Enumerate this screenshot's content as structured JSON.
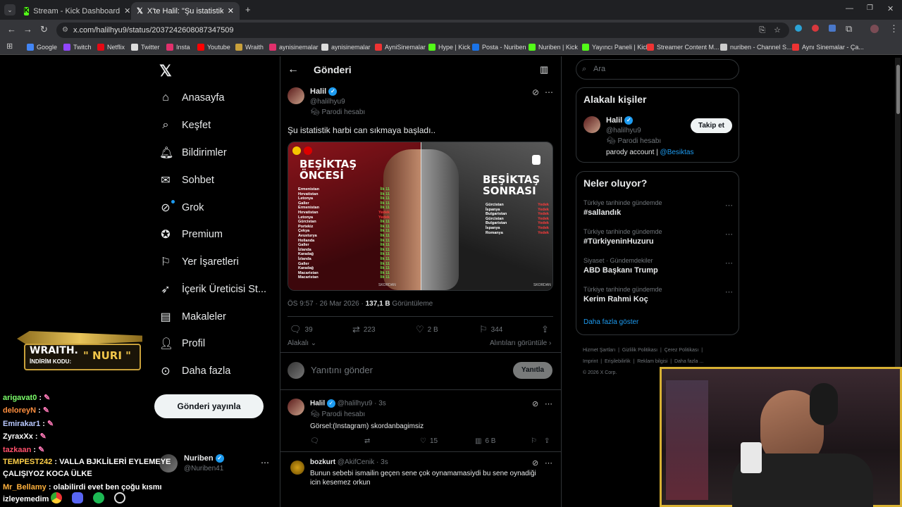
{
  "browser": {
    "tabs": [
      "Stream - Kick Dashboard",
      "X'te Halil: \"Şu istatistik harbi ca"
    ],
    "url": "x.com/halilhyu9/status/2037242608087347509",
    "bookmarks": [
      "Google",
      "Twitch",
      "Netflix",
      "Twitter",
      "Insta",
      "Youtube",
      "Wraith",
      "aynisinemalar",
      "aynisinemalar",
      "AyniSinemalar",
      "Hype | Kick",
      "Posta - Nuriben",
      "Nuriben | Kick",
      "Yayıncı Paneli | Kick",
      "Streamer Content M...",
      "nuriben - Channel S...",
      "Aynı Sinemalar - Ça..."
    ]
  },
  "nav": {
    "items": [
      "Anasayfa",
      "Keşfet",
      "Bildirimler",
      "Sohbet",
      "Grok",
      "Premium",
      "Yer İşaretleri",
      "İçerik Üreticisi St...",
      "Makaleler",
      "Profil",
      "Daha fazla"
    ],
    "post_button": "Gönderi yayınla",
    "account_name": "Nuriben",
    "account_handle": "@Nuriben41"
  },
  "header": {
    "title": "Gönderi"
  },
  "post": {
    "name": "Halil",
    "handle": "@halilhyu9",
    "parody": "Parodi hesabı",
    "text": "Şu istatistik harbi can sıkmaya başladı..",
    "meta_time": "ÖS 9:57 · 26 Mar 2026 · ",
    "views": "137,1 B",
    "views_label": " Görüntüleme",
    "replies": "39",
    "reposts": "223",
    "likes": "2 B",
    "bookmarks": "344",
    "relevance": "Alakalı",
    "quotes": "Alıntıları görüntüle",
    "reply_placeholder": "Yanıtını gönder",
    "reply_button": "Yanıtla"
  },
  "infographic": {
    "left_title_1": "BEŞİKTAŞ",
    "left_title_2": "ÖNCESİ",
    "right_title_1": "BEŞİKTAŞ",
    "right_title_2": "SONRASI",
    "left_rows": [
      "Ermenistan",
      "Hırvatistan",
      "Letonya",
      "Galler",
      "Ermenistan",
      "Hırvatistan",
      "Letonya",
      "Gürcistan",
      "Portekiz",
      "Çekya",
      "Avusturya",
      "Hollanda",
      "Galler",
      "İzlanda",
      "Karadağ",
      "İzlanda",
      "Galler",
      "Karadağ",
      "Macaristan",
      "Macaristan"
    ],
    "left_status": [
      "İlk 11",
      "İlk 11",
      "İlk 11",
      "İlk 11",
      "İlk 11",
      "Yedek",
      "Yedek",
      "İlk 11",
      "İlk 11",
      "İlk 11",
      "İlk 11",
      "İlk 11",
      "İlk 11",
      "İlk 11",
      "İlk 11",
      "İlk 11",
      "İlk 11",
      "İlk 11",
      "İlk 11",
      "İlk 11"
    ],
    "right_rows": [
      "Gürcistan",
      "İspanya",
      "Bulgaristan",
      "Gürcistan",
      "Bulgaristan",
      "İspanya",
      "Romanya"
    ],
    "right_status": [
      "Yedek",
      "Yedek",
      "Yedek",
      "Yedek",
      "Yedek",
      "Yedek",
      "Yedek"
    ],
    "brand": "SKORDAN"
  },
  "replies": [
    {
      "name": "Halil",
      "handle": "@halilhyu9 · 3s",
      "parody": "Parodi hesabı",
      "text": "Görsel:(Instagram) skordanbagimsiz",
      "likes": "15",
      "views": "6 B"
    },
    {
      "name": "bozkurt",
      "handle": "@AkifCenik · 3s",
      "text": "Bunun sebebi ismailin geçen sene çok oynamamasiydi bu sene oynadiği icin kesemez orkun"
    }
  ],
  "search": {
    "placeholder": "Ara"
  },
  "related": {
    "title": "Alakalı kişiler",
    "name": "Halil",
    "handle": "@halilhyu9",
    "parody": "Parodi hesabı",
    "bio": "parody account | ",
    "bio_link": "@Besiktas",
    "follow": "Takip et"
  },
  "trends": {
    "title": "Neler oluyor?",
    "items": [
      {
        "context": "Türkiye tarihinde gündemde",
        "name": "#sallandık"
      },
      {
        "context": "Türkiye tarihinde gündemde",
        "name": "#TürkiyeninHuzuru"
      },
      {
        "context": "Siyaset · Gündemdekiler",
        "name": "ABD Başkanı Trump"
      },
      {
        "context": "Türkiye tarihinde gündemde",
        "name": "Kerim Rahmi Koç"
      }
    ],
    "more": "Daha fazla göster"
  },
  "footer": [
    "Hizmet Şartları",
    "Gizlilik Politikası",
    "Çerez Politikası",
    "Imprint",
    "Erişilebilirlik",
    "Reklam bilgisi",
    "Daha fazla ...",
    "© 2026 X Corp."
  ],
  "overlay": {
    "logo": "WRAITH.",
    "code_label": "İNDİRİM KODU:",
    "code": "\" NURI \"",
    "chat": [
      {
        "user": "arigavat0",
        "msg": " : ",
        "color": "#7cff6b"
      },
      {
        "user": "deloreyN",
        "msg": " : ",
        "color": "#ff8f3f"
      },
      {
        "user": "Emirakar1",
        "msg": " : ",
        "color": "#b8c8ff"
      },
      {
        "user": "ZyraxXx",
        "msg": " : ",
        "color": "#ffffff"
      },
      {
        "user": "tazkaan",
        "msg": " : ",
        "color": "#ff4f6a"
      },
      {
        "user": "TEMPEST242",
        "msg": " : VALLA BJKLİLERİ EYLEMEYE",
        "color": "#ffd04a"
      },
      {
        "user": "",
        "msg": "ÇALIŞIYOZ KOCA ÜLKE",
        "color": "#ffffff"
      },
      {
        "user": "Mr_Bellamy",
        "msg": " : olabilirdi evet ben çoğu kısmı",
        "color": "#ffb13d"
      },
      {
        "user": "",
        "msg": "izleyemedim",
        "color": "#ffffff"
      }
    ]
  },
  "colors": {
    "accent": "#1d9bf0",
    "kick": "#53fc18",
    "bg": "#000000",
    "border": "#2f3336"
  }
}
